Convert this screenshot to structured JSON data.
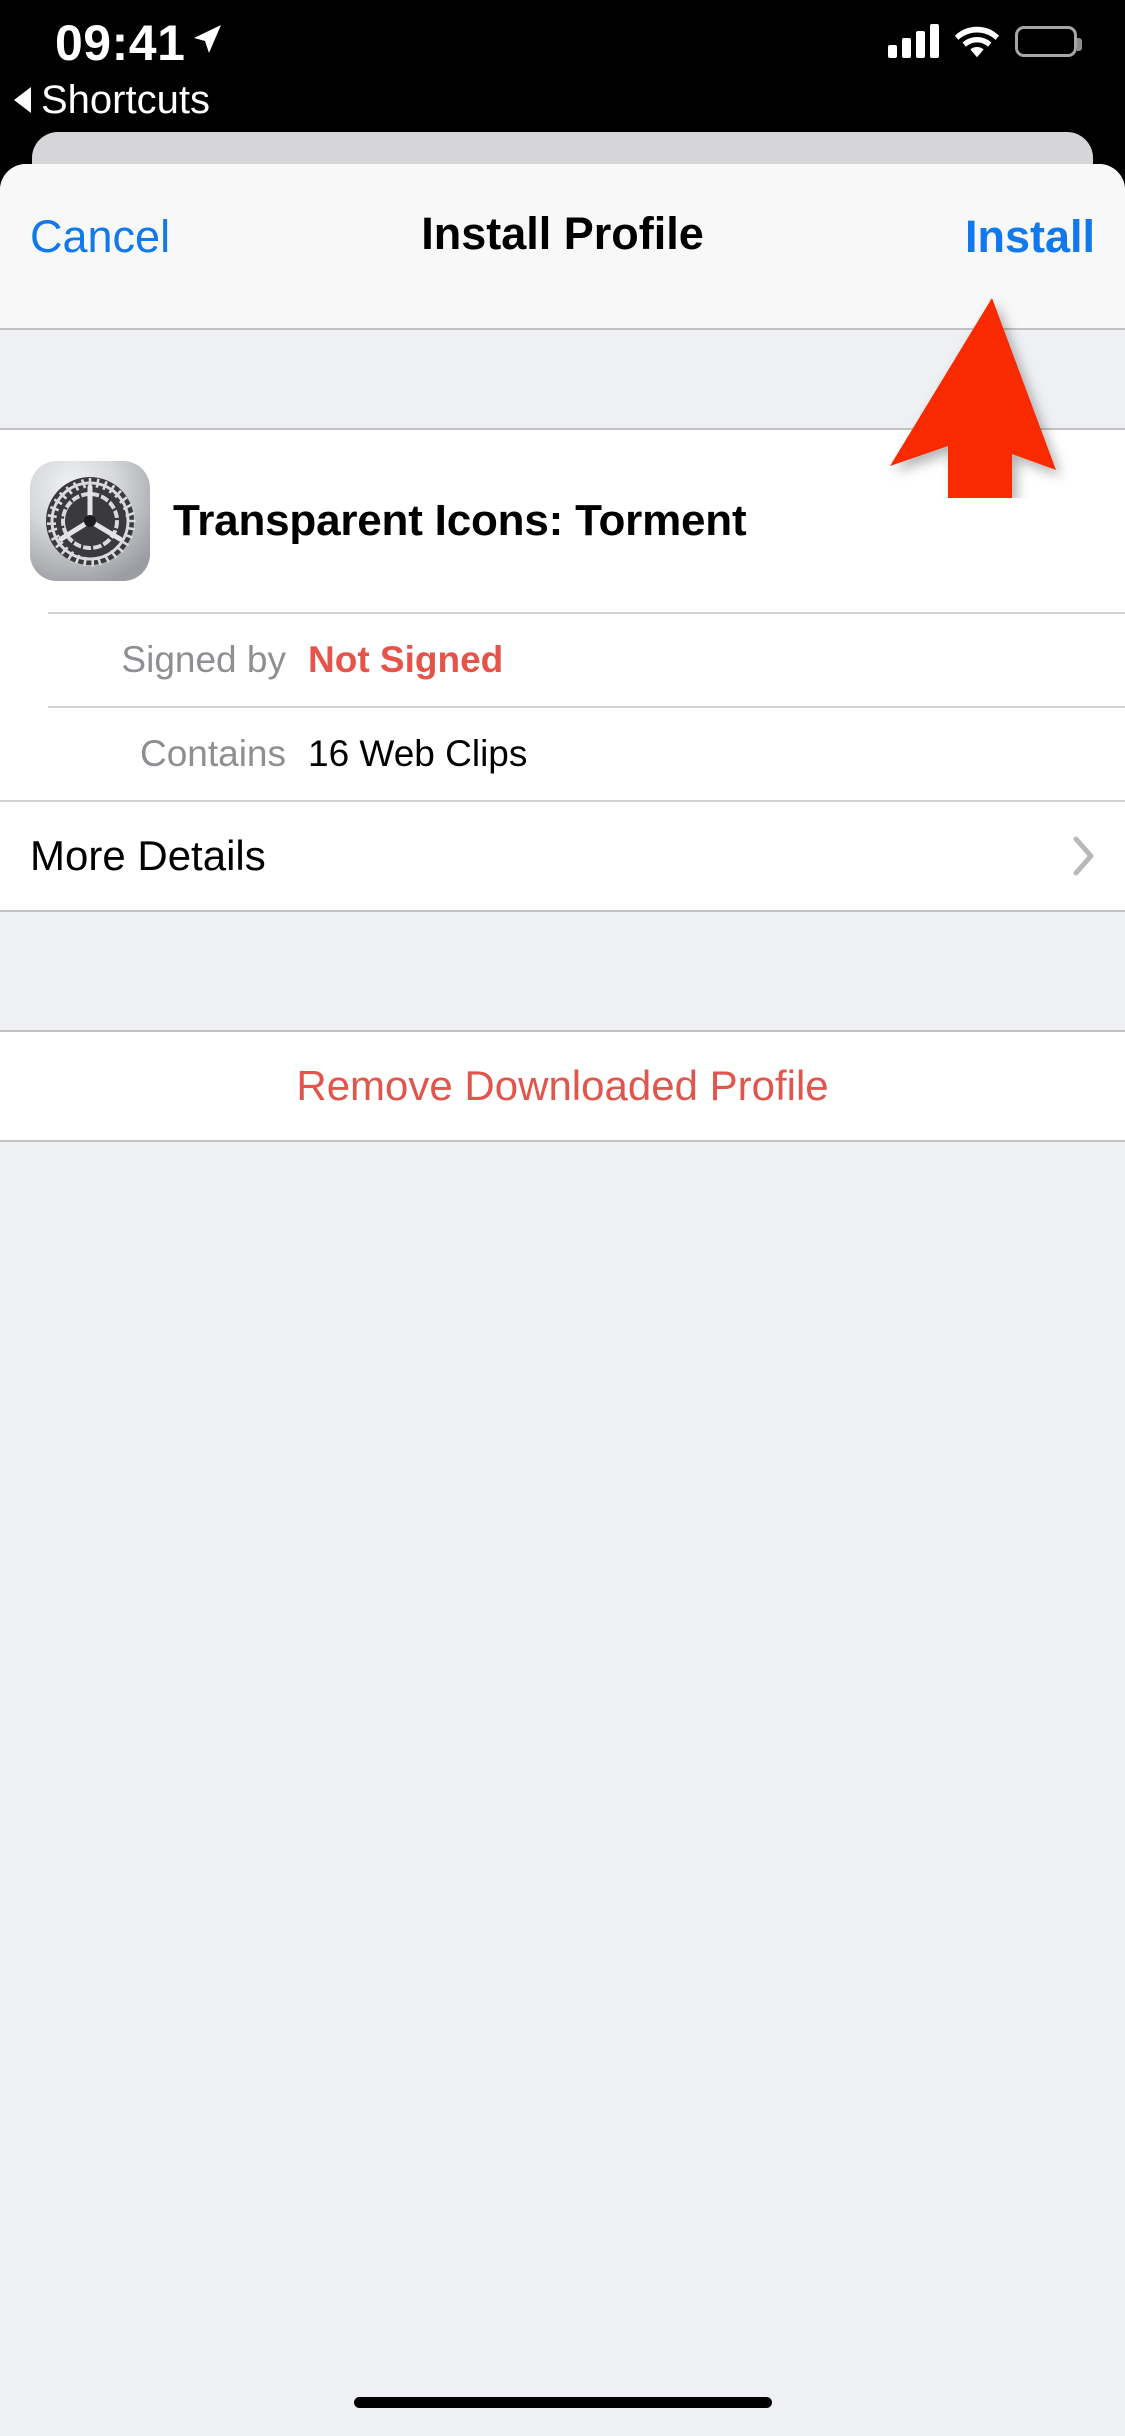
{
  "status_bar": {
    "time": "09:41",
    "location_icon": "location-arrow-icon",
    "back_indicator": {
      "icon": "back-triangle-icon",
      "label": "Shortcuts"
    },
    "cellular_icon": "signal-bars-icon",
    "wifi_icon": "wifi-icon",
    "battery_icon": "battery-full-icon"
  },
  "nav_bar": {
    "cancel_label": "Cancel",
    "title": "Install Profile",
    "install_label": "Install"
  },
  "profile": {
    "icon": "settings-gear-icon",
    "name": "Transparent Icons: Torment",
    "details": [
      {
        "label": "Signed by",
        "value": "Not Signed",
        "style": "danger"
      },
      {
        "label": "Contains",
        "value": "16 Web Clips",
        "style": "normal"
      }
    ],
    "more_details_label": "More Details",
    "more_details_chevron": "chevron-right-icon"
  },
  "actions": {
    "remove_label": "Remove Downloaded Profile"
  },
  "annotation": {
    "arrow": "red-up-arrow-annotation",
    "points_at": "Install"
  },
  "colors": {
    "tint_blue": "#1179ec",
    "destructive_red": "#e0564c",
    "not_signed_red": "#e4544a",
    "group_background": "#eff0f4",
    "cell_background": "#ffffff",
    "separator": "#c2c2c5",
    "secondary_label": "#8e8e93",
    "annotation_red": "#f92b00"
  }
}
